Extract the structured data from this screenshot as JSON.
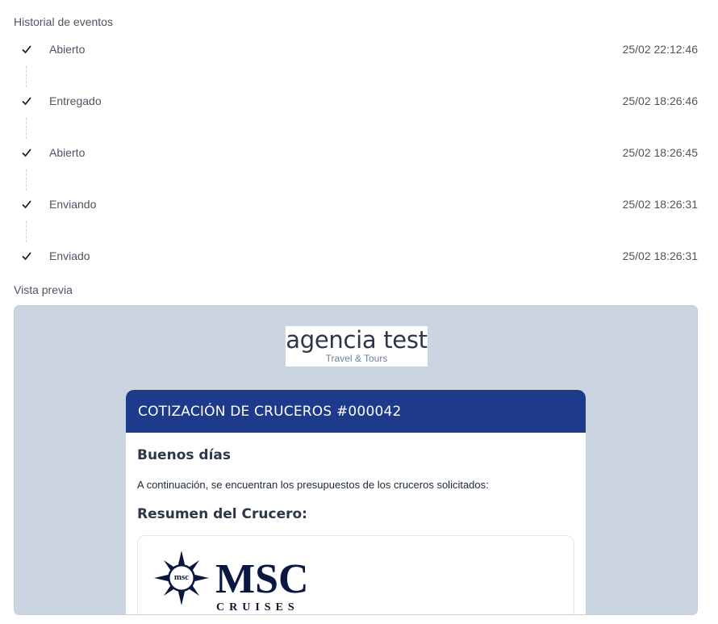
{
  "history": {
    "title": "Historial de eventos",
    "events": [
      {
        "status": "Abierto",
        "time": "25/02 22:12:46"
      },
      {
        "status": "Entregado",
        "time": "25/02 18:26:46"
      },
      {
        "status": "Abierto",
        "time": "25/02 18:26:45"
      },
      {
        "status": "Enviando",
        "time": "25/02 18:26:31"
      },
      {
        "status": "Enviado",
        "time": "25/02 18:26:31"
      }
    ]
  },
  "preview": {
    "title": "Vista previa",
    "logo": {
      "name": "agencia test",
      "tagline": "Travel & Tours"
    },
    "email": {
      "header": "COTIZACIÓN DE CRUCEROS #000042",
      "greeting": "Buenos días",
      "intro": "A continuación, se encuentran los presupuestos de los cruceros solicitados:",
      "summary_title": "Resumen del Crucero:",
      "cruise_logo": {
        "brand": "MSC",
        "sub": "CRUISES",
        "emblem": "msc"
      }
    }
  },
  "colors": {
    "header_bg": "#1e3a8a",
    "preview_bg": "#cbd5e1",
    "msc_navy": "#0a1740"
  }
}
